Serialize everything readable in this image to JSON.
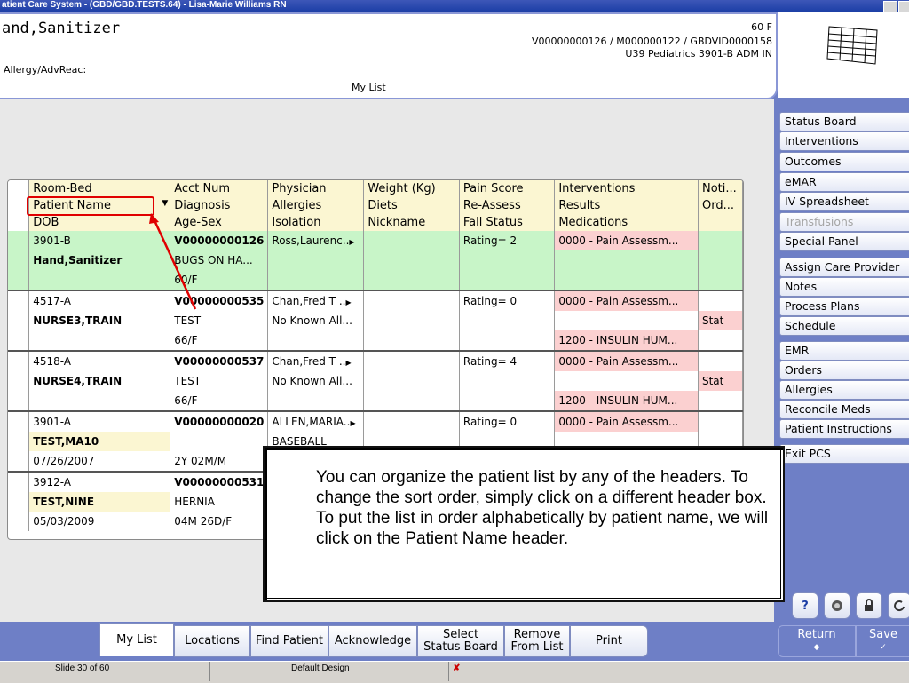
{
  "window": {
    "title": "atient Care System - (GBD/GBD.TESTS.64) - Lisa-Marie Williams RN"
  },
  "header": {
    "patient_name": "and,Sanitizer",
    "allergy_label": "Allergy/AdvReac:",
    "sex_age": "60 F",
    "ids_line1": "V00000000126 / M000000122 / GBDVID0000158",
    "ids_line2": "U39 Pediatrics  3901-B  ADM IN",
    "list_label": "My List"
  },
  "table": {
    "header_rows": [
      [
        "Room-Bed",
        "Acct Num",
        "Physician",
        "Weight (Kg)",
        "Pain Score",
        "Interventions",
        "Noti..."
      ],
      [
        "Patient Name",
        "Diagnosis",
        "Allergies",
        "Diets",
        "Re-Assess",
        "Results",
        "Ord..."
      ],
      [
        "DOB",
        "Age-Sex",
        "Isolation",
        "Nickname",
        "Fall Status",
        "Medications",
        ""
      ]
    ],
    "sort_indicator": "▼",
    "patients": [
      {
        "room": "3901-B",
        "acct": "V00000000126",
        "physician": "Ross,Laurenc..",
        "pain": "Rating= 2",
        "intervention": "0000 - Pain Assessm...",
        "name": "Hand,Sanitizer",
        "diagnosis": "BUGS ON HA...",
        "age_sex": "60/F",
        "dob": "",
        "allergies": "",
        "stat": "",
        "medication": "",
        "isolation": ""
      },
      {
        "room": "4517-A",
        "acct": "V00000000535",
        "physician": "Chan,Fred T ..",
        "pain": "Rating= 0",
        "intervention": "0000 - Pain Assessm...",
        "name": "NURSE3,TRAIN",
        "diagnosis": "TEST",
        "age_sex": "66/F",
        "dob": "",
        "allergies": "No Known All...",
        "stat": "Stat",
        "medication": "1200 - INSULIN HUM...",
        "isolation": ""
      },
      {
        "room": "4518-A",
        "acct": "V00000000537",
        "physician": "Chan,Fred T ..",
        "pain": "Rating= 4",
        "intervention": "0000 - Pain Assessm...",
        "name": "NURSE4,TRAIN",
        "diagnosis": "TEST",
        "age_sex": "66/F",
        "dob": "",
        "allergies": "No Known All...",
        "stat": "Stat",
        "medication": "1200 - INSULIN HUM...",
        "isolation": ""
      },
      {
        "room": "3901-A",
        "acct": "V00000000020",
        "physician": "ALLEN,MARIA..",
        "pain": "Rating= 0",
        "intervention": "0000 - Pain Assessm...",
        "name": "TEST,MA10",
        "diagnosis": "",
        "age_sex": "2Y 02M/M",
        "dob": "07/26/2007",
        "allergies": "BASEBALL",
        "stat": "",
        "medication": "",
        "isolation": ""
      },
      {
        "room": "3912-A",
        "acct": "V00000000531",
        "physician": "",
        "pain": "",
        "intervention": "",
        "name": "TEST,NINE",
        "diagnosis": "HERNIA",
        "age_sex": "04M 26D/F",
        "dob": "05/03/2009",
        "allergies": "",
        "stat": "",
        "medication": "",
        "isolation": ""
      }
    ]
  },
  "sidebar": {
    "items": [
      {
        "label": "Status Board",
        "enabled": true
      },
      {
        "label": "Interventions",
        "enabled": true
      },
      {
        "label": "Outcomes",
        "enabled": true
      },
      {
        "label": "eMAR",
        "enabled": true
      },
      {
        "label": "IV Spreadsheet",
        "enabled": true
      },
      {
        "label": "Transfusions",
        "enabled": false
      },
      {
        "label": "Special Panel",
        "enabled": true
      },
      {
        "label": "Assign Care Provider",
        "enabled": true
      },
      {
        "label": "Notes",
        "enabled": true
      },
      {
        "label": "Process Plans",
        "enabled": true
      },
      {
        "label": "Schedule",
        "enabled": true
      },
      {
        "label": "EMR",
        "enabled": true
      },
      {
        "label": "Orders",
        "enabled": true
      },
      {
        "label": "Allergies",
        "enabled": true
      },
      {
        "label": "Reconcile Meds",
        "enabled": true
      },
      {
        "label": "Patient Instructions",
        "enabled": true
      },
      {
        "label": "Exit PCS",
        "enabled": true
      }
    ]
  },
  "callout": {
    "text": "You can organize the patient list by any of the headers. To change the sort order, simply click on a different header box. To put the list in order alphabetically by patient name, we will click on the Patient Name header."
  },
  "bottom_nav": {
    "my_list": "My List",
    "locations": "Locations",
    "find_patient": "Find Patient",
    "acknowledge": "Acknowledge",
    "select_status_board": "Select\nStatus Board",
    "remove_from_list": "Remove\nFrom List",
    "print": "Print",
    "return": "Return",
    "save": "Save"
  },
  "icon_buttons": {
    "help": "?"
  },
  "statusbar": {
    "slide": "Slide 30 of 60",
    "design": "Default Design"
  },
  "colors": {
    "background": "#6e7fc6",
    "highlight_box": "#e00000",
    "selected_row": "#c8f5c8",
    "alert": "#fbd0d0",
    "header_row": "#fbf6d2"
  }
}
